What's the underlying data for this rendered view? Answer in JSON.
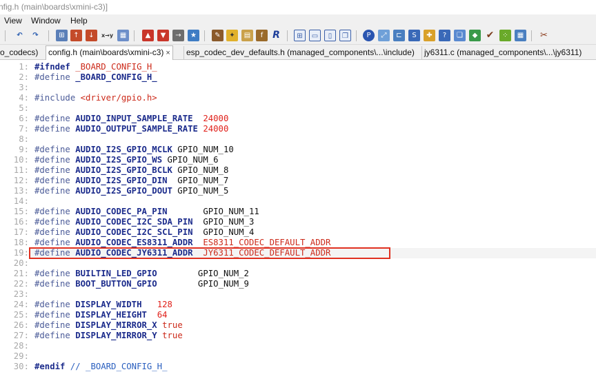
{
  "window": {
    "title": "nfig.h (main\\boards\\xmini-c3)]"
  },
  "menu": {
    "items": [
      "View",
      "Window",
      "Help"
    ]
  },
  "toolbar": {
    "icons": [
      "undo-icon",
      "redo-icon",
      "binoculars-icon",
      "find-up-icon",
      "find-down-icon",
      "replace-xy-icon",
      "find-files-icon",
      "bookmark-up-icon",
      "bookmark-down-icon",
      "bookmark-toggle-icon",
      "bookmark-clear-icon",
      "pin-icon",
      "new-folder-icon",
      "open-book-icon",
      "formula-icon",
      "script-icon",
      "split-grid-icon",
      "split-horizontal-icon",
      "split-vertical-icon",
      "cascade-icon",
      "p-icon",
      "resize-icon",
      "tree-icon",
      "s-icon",
      "puzzle-icon",
      "question-box-icon",
      "copy-icon",
      "shapes-icon",
      "bird-icon",
      "dots-icon",
      "grid-icon",
      "wrench-icon"
    ]
  },
  "tabs": [
    {
      "label": "o_codecs)",
      "active": false
    },
    {
      "label": "config.h (main\\boards\\xmini-c3)",
      "active": true,
      "close": "×"
    },
    {
      "label": "esp_codec_dev_defaults.h (managed_components\\...\\include)",
      "active": false
    },
    {
      "label": "jy6311.c (managed_components\\...\\jy6311)",
      "active": false
    }
  ],
  "code": {
    "current_line": 19,
    "highlighted_line": 19,
    "lines": [
      {
        "n": "1:",
        "parts": [
          [
            "kw",
            "#ifndef"
          ],
          [
            "val",
            " "
          ],
          [
            "str",
            "_BOARD_CONFIG_H_"
          ]
        ]
      },
      {
        "n": "2:",
        "parts": [
          [
            "pp",
            "#define"
          ],
          [
            "val",
            " "
          ],
          [
            "id",
            "_BOARD_CONFIG_H_"
          ]
        ]
      },
      {
        "n": "3:",
        "parts": []
      },
      {
        "n": "4:",
        "parts": [
          [
            "pp",
            "#include"
          ],
          [
            "val",
            " "
          ],
          [
            "str",
            "<driver/gpio.h>"
          ]
        ]
      },
      {
        "n": "5:",
        "parts": []
      },
      {
        "n": "6:",
        "parts": [
          [
            "pp",
            "#define"
          ],
          [
            "val",
            " "
          ],
          [
            "id",
            "AUDIO_INPUT_SAMPLE_RATE"
          ],
          [
            "val",
            "  "
          ],
          [
            "num",
            "24000"
          ]
        ]
      },
      {
        "n": "7:",
        "parts": [
          [
            "pp",
            "#define"
          ],
          [
            "val",
            " "
          ],
          [
            "id",
            "AUDIO_OUTPUT_SAMPLE_RATE"
          ],
          [
            "val",
            " "
          ],
          [
            "num",
            "24000"
          ]
        ]
      },
      {
        "n": "8:",
        "parts": []
      },
      {
        "n": "9:",
        "parts": [
          [
            "pp",
            "#define"
          ],
          [
            "val",
            " "
          ],
          [
            "id",
            "AUDIO_I2S_GPIO_MCLK"
          ],
          [
            "val",
            " GPIO_NUM_10"
          ]
        ]
      },
      {
        "n": "10:",
        "parts": [
          [
            "pp",
            "#define"
          ],
          [
            "val",
            " "
          ],
          [
            "id",
            "AUDIO_I2S_GPIO_WS"
          ],
          [
            "val",
            " GPIO_NUM_6"
          ]
        ]
      },
      {
        "n": "11:",
        "parts": [
          [
            "pp",
            "#define"
          ],
          [
            "val",
            " "
          ],
          [
            "id",
            "AUDIO_I2S_GPIO_BCLK"
          ],
          [
            "val",
            " GPIO_NUM_8"
          ]
        ]
      },
      {
        "n": "12:",
        "parts": [
          [
            "pp",
            "#define"
          ],
          [
            "val",
            " "
          ],
          [
            "id",
            "AUDIO_I2S_GPIO_DIN"
          ],
          [
            "val",
            "  GPIO_NUM_7"
          ]
        ]
      },
      {
        "n": "13:",
        "parts": [
          [
            "pp",
            "#define"
          ],
          [
            "val",
            " "
          ],
          [
            "id",
            "AUDIO_I2S_GPIO_DOUT"
          ],
          [
            "val",
            " GPIO_NUM_5"
          ]
        ]
      },
      {
        "n": "14:",
        "parts": []
      },
      {
        "n": "15:",
        "parts": [
          [
            "pp",
            "#define"
          ],
          [
            "val",
            " "
          ],
          [
            "id",
            "AUDIO_CODEC_PA_PIN"
          ],
          [
            "val",
            "       GPIO_NUM_11"
          ]
        ]
      },
      {
        "n": "16:",
        "parts": [
          [
            "pp",
            "#define"
          ],
          [
            "val",
            " "
          ],
          [
            "id",
            "AUDIO_CODEC_I2C_SDA_PIN"
          ],
          [
            "val",
            "  GPIO_NUM_3"
          ]
        ]
      },
      {
        "n": "17:",
        "parts": [
          [
            "pp",
            "#define"
          ],
          [
            "val",
            " "
          ],
          [
            "id",
            "AUDIO_CODEC_I2C_SCL_PIN"
          ],
          [
            "val",
            "  GPIO_NUM_4"
          ]
        ]
      },
      {
        "n": "18:",
        "parts": [
          [
            "pp",
            "#define"
          ],
          [
            "val",
            " "
          ],
          [
            "id",
            "AUDIO_CODEC_ES8311_ADDR"
          ],
          [
            "val",
            "  "
          ],
          [
            "tr",
            "ES8311_CODEC_DEFAULT_ADDR"
          ]
        ]
      },
      {
        "n": "19:",
        "parts": [
          [
            "pp",
            "#define"
          ],
          [
            "val",
            " "
          ],
          [
            "id",
            "AUDIO_CODEC_JY6311_ADDR"
          ],
          [
            "val",
            "  "
          ],
          [
            "tr",
            "JY6311_CODEC_DEFAULT_ADDR"
          ]
        ]
      },
      {
        "n": "20:",
        "parts": []
      },
      {
        "n": "21:",
        "parts": [
          [
            "pp",
            "#define"
          ],
          [
            "val",
            " "
          ],
          [
            "id",
            "BUILTIN_LED_GPIO"
          ],
          [
            "val",
            "        GPIO_NUM_2"
          ]
        ]
      },
      {
        "n": "22:",
        "parts": [
          [
            "pp",
            "#define"
          ],
          [
            "val",
            " "
          ],
          [
            "id",
            "BOOT_BUTTON_GPIO"
          ],
          [
            "val",
            "        GPIO_NUM_9"
          ]
        ]
      },
      {
        "n": "23:",
        "parts": []
      },
      {
        "n": "24:",
        "parts": [
          [
            "pp",
            "#define"
          ],
          [
            "val",
            " "
          ],
          [
            "id",
            "DISPLAY_WIDTH"
          ],
          [
            "val",
            "   "
          ],
          [
            "num",
            "128"
          ]
        ]
      },
      {
        "n": "25:",
        "parts": [
          [
            "pp",
            "#define"
          ],
          [
            "val",
            " "
          ],
          [
            "id",
            "DISPLAY_HEIGHT"
          ],
          [
            "val",
            "  "
          ],
          [
            "num",
            "64"
          ]
        ]
      },
      {
        "n": "26:",
        "parts": [
          [
            "pp",
            "#define"
          ],
          [
            "val",
            " "
          ],
          [
            "id",
            "DISPLAY_MIRROR_X"
          ],
          [
            "val",
            " "
          ],
          [
            "tr",
            "true"
          ]
        ]
      },
      {
        "n": "27:",
        "parts": [
          [
            "pp",
            "#define"
          ],
          [
            "val",
            " "
          ],
          [
            "id",
            "DISPLAY_MIRROR_Y"
          ],
          [
            "val",
            " "
          ],
          [
            "tr",
            "true"
          ]
        ]
      },
      {
        "n": "28:",
        "parts": []
      },
      {
        "n": "29:",
        "parts": []
      },
      {
        "n": "30:",
        "parts": [
          [
            "kw",
            "#endif"
          ],
          [
            "val",
            " "
          ],
          [
            "cmt",
            "// _BOARD_CONFIG_H_"
          ]
        ]
      }
    ]
  },
  "colors": {
    "highlight_box": "#e03020",
    "keyword": "#1c2c8c",
    "string": "#cc2a1a"
  }
}
